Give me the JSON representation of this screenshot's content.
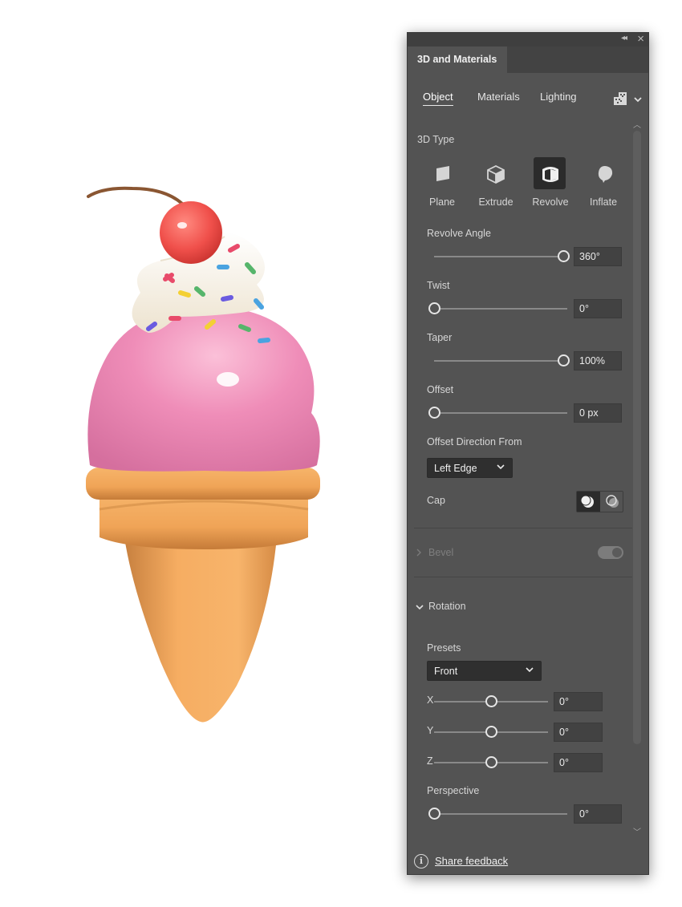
{
  "panel": {
    "title": "3D and Materials",
    "tabs": [
      "Object",
      "Materials",
      "Lighting"
    ],
    "active_tab": "Object",
    "type_section_label": "3D Type",
    "types": [
      {
        "label": "Plane",
        "icon": "plane-icon"
      },
      {
        "label": "Extrude",
        "icon": "extrude-icon"
      },
      {
        "label": "Revolve",
        "icon": "revolve-icon"
      },
      {
        "label": "Inflate",
        "icon": "inflate-icon"
      }
    ],
    "active_type": "Revolve",
    "revolve_angle": {
      "label": "Revolve Angle",
      "value": "360°",
      "level": 1.0
    },
    "twist": {
      "label": "Twist",
      "value": "0°",
      "level": 0.0
    },
    "taper": {
      "label": "Taper",
      "value": "100%",
      "level": 1.0
    },
    "offset": {
      "label": "Offset",
      "value": "0 px",
      "level": 0.0
    },
    "offset_direction": {
      "label": "Offset Direction From",
      "value": "Left Edge"
    },
    "cap": {
      "label": "Cap"
    },
    "bevel": {
      "label": "Bevel",
      "enabled": false
    },
    "rotation": {
      "label": "Rotation",
      "presets_label": "Presets",
      "preset_value": "Front",
      "x": {
        "label": "X",
        "value": "0°",
        "level": 0.5
      },
      "y": {
        "label": "Y",
        "value": "0°",
        "level": 0.5
      },
      "z": {
        "label": "Z",
        "value": "0°",
        "level": 0.5
      },
      "perspective": {
        "label": "Perspective",
        "value": "0°",
        "level": 0.0
      }
    },
    "footer": {
      "link": "Share feedback"
    }
  },
  "colors": {
    "panel_bg": "#535353",
    "cream_pink": "#ee8fb7",
    "cone": "#f2a95f",
    "cherry": "#f0504b",
    "whipped": "#fbf6e9"
  }
}
